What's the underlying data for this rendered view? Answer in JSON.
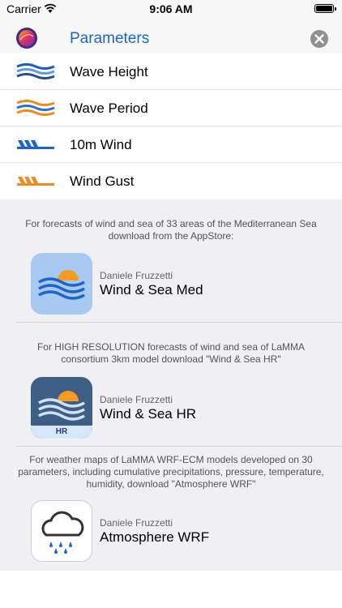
{
  "status_bar": {
    "carrier": "Carrier",
    "time": "9:06 AM"
  },
  "navbar": {
    "title": "Parameters",
    "close_icon": "close-circle-icon"
  },
  "parameters": [
    {
      "label": "Wave Height",
      "icon": "wave-height-icon",
      "color": "#1f64c9"
    },
    {
      "label": "Wave Period",
      "icon": "wave-period-icon",
      "color": "#f08a1c"
    },
    {
      "label": "10m Wind",
      "icon": "wind-barb-icon",
      "color": "#1f64c9"
    },
    {
      "label": "Wind Gust",
      "icon": "wind-gust-icon",
      "color": "#f08a1c"
    }
  ],
  "promos": [
    {
      "description": "For forecasts of wind and sea of 33 areas of the Mediterranean Sea download from the AppStore:",
      "developer": "Daniele Fruzzetti",
      "app_name": "Wind & Sea Med"
    },
    {
      "description": "For HIGH RESOLUTION forecasts of wind and sea of LaMMA consortium 3km model download \"Wind & Sea HR\"",
      "developer": "Daniele Fruzzetti",
      "app_name": "Wind & Sea HR",
      "badge": "HR"
    },
    {
      "description": "For weather maps of LaMMA WRF-ECM models developed on 30 parameters, including cumulative precipitations, pressure, temperature, humidity, download \"Atmosphere WRF\"",
      "developer": "Daniele Fruzzetti",
      "app_name": "Atmosphere WRF"
    }
  ],
  "colors": {
    "accent": "#1f64c9",
    "orange": "#f08a1c",
    "background": "#efeff4"
  }
}
